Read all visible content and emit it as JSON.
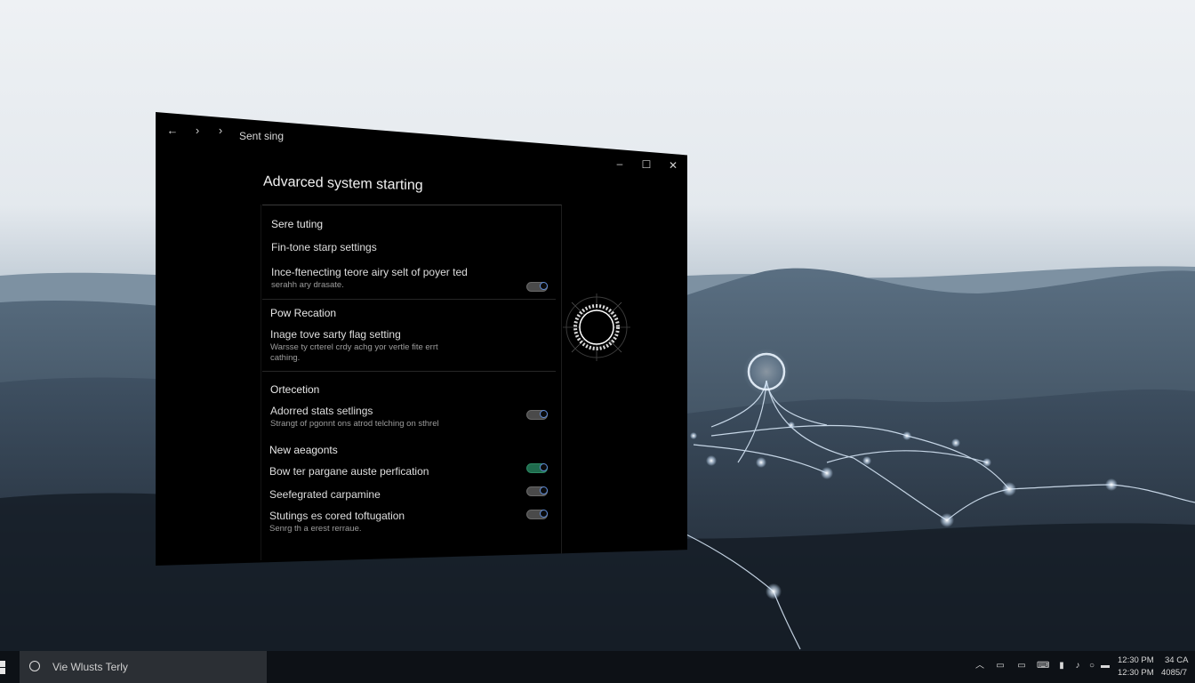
{
  "window": {
    "title": "Sent sing",
    "nav": {
      "back": "←",
      "forward": "›",
      "forward2": "›"
    },
    "controls": {
      "minimize": "–",
      "maximize": "☐",
      "close": "✕"
    }
  },
  "page": {
    "title": "Advarced system starting",
    "sections": [
      {
        "heading": "Sere tuting",
        "items": [
          {
            "title": "Fin-tone starp settings",
            "desc": ""
          },
          {
            "title": "Ince-ftenecting teore airy selt of poyer ted",
            "desc": "serahh ary drasate.",
            "toggle": true
          }
        ]
      },
      {
        "heading": "Pow Recation",
        "items": [
          {
            "title": "Inage tove sarty flag setting",
            "desc": "Warsse ty crterel crdy achg yor vertle fite errt",
            "desc2": "cathing."
          }
        ]
      },
      {
        "heading": "Ortecetion",
        "items": [
          {
            "title": "Adorred stats setlings",
            "desc": "Strangt of pgonnt ons atrod telching on sthrel",
            "toggle": true
          }
        ]
      },
      {
        "heading": "New aeagonts",
        "items": [
          {
            "title": "Bow ter pargane auste perfication",
            "toggle": true,
            "on": true
          },
          {
            "title": "Seefegrated carpamine",
            "toggle": true
          },
          {
            "title": "Stutings es cored toftugation",
            "desc": "Senrg th a erest rerraue.",
            "toggle": true
          }
        ]
      }
    ]
  },
  "taskbar": {
    "search_placeholder": "Vie Wlusts Terly",
    "tray": {
      "time": "12:30 PM",
      "date": "12:30 PM",
      "time2": "34 CA",
      "date2": "4085/7"
    },
    "tray_icons": [
      "chevron-up-icon",
      "network-icon",
      "display-icon",
      "keyboard-icon",
      "battery-icon",
      "volume-icon",
      "circle-icon",
      "notification-icon"
    ]
  },
  "colors": {
    "window_bg": "#000000",
    "accent_toggle": "#5e8bd8",
    "toggle_on": "#1f6b4d",
    "taskbar": "#0d1116"
  }
}
